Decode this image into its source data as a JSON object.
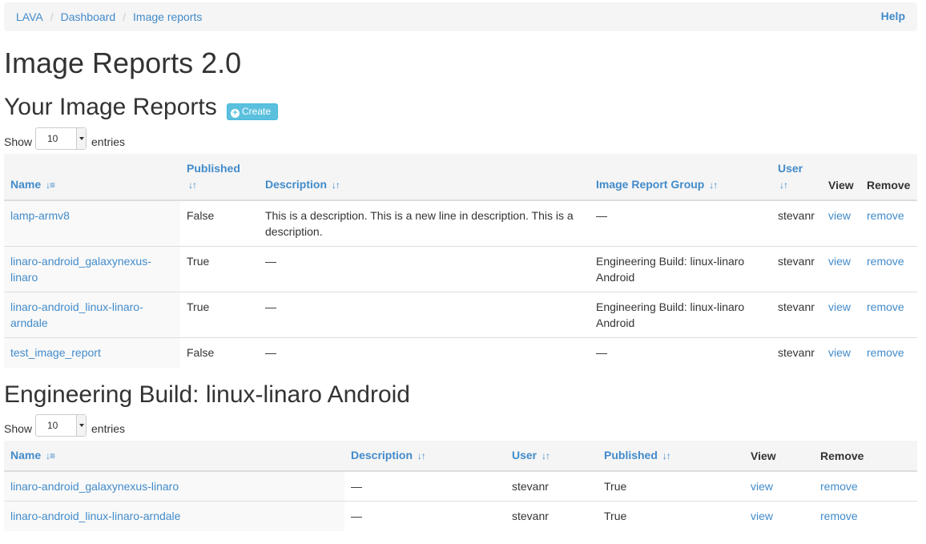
{
  "breadcrumb": {
    "items": [
      "LAVA",
      "Dashboard",
      "Image reports"
    ],
    "separator": "/",
    "help": "Help"
  },
  "page_title": "Image Reports 2.0",
  "your_reports": {
    "title": "Your Image Reports",
    "create_label": "Create",
    "length": {
      "show": "Show",
      "value": "10",
      "entries": "entries"
    },
    "columns": [
      "Name",
      "Published",
      "Description",
      "Image Report Group",
      "User",
      "View",
      "Remove"
    ],
    "rows": [
      {
        "name": "lamp-armv8",
        "published": "False",
        "description": "This is a description. This is a new line in description. This is a description.",
        "group": "—",
        "user": "stevanr",
        "view": "view",
        "remove": "remove"
      },
      {
        "name": "linaro-android_galaxynexus-linaro",
        "published": "True",
        "description": "—",
        "group": "Engineering Build: linux-linaro Android",
        "user": "stevanr",
        "view": "view",
        "remove": "remove"
      },
      {
        "name": "linaro-android_linux-linaro-arndale",
        "published": "True",
        "description": "—",
        "group": "Engineering Build: linux-linaro Android",
        "user": "stevanr",
        "view": "view",
        "remove": "remove"
      },
      {
        "name": "test_image_report",
        "published": "False",
        "description": "—",
        "group": "—",
        "user": "stevanr",
        "view": "view",
        "remove": "remove"
      }
    ]
  },
  "group_section": {
    "title": "Engineering Build: linux-linaro Android",
    "length": {
      "show": "Show",
      "value": "10",
      "entries": "entries"
    },
    "columns": [
      "Name",
      "Description",
      "User",
      "Published",
      "View",
      "Remove"
    ],
    "rows": [
      {
        "name": "linaro-android_galaxynexus-linaro",
        "description": "—",
        "user": "stevanr",
        "published": "True",
        "view": "view",
        "remove": "remove"
      },
      {
        "name": "linaro-android_linux-linaro-arndale",
        "description": "—",
        "user": "stevanr",
        "published": "True",
        "view": "view",
        "remove": "remove"
      }
    ]
  },
  "icons": {
    "sort_asc": "sort-ascending-icon",
    "sort_both": "sort-both-icon",
    "create": "plus-circle-icon",
    "select_arrow": "caret-down-icon"
  },
  "colors": {
    "link": "#428bca",
    "info_button": "#5bc0de",
    "header_bg": "#f5f5f5",
    "sorted_col_bg": "#f9f9f9"
  }
}
